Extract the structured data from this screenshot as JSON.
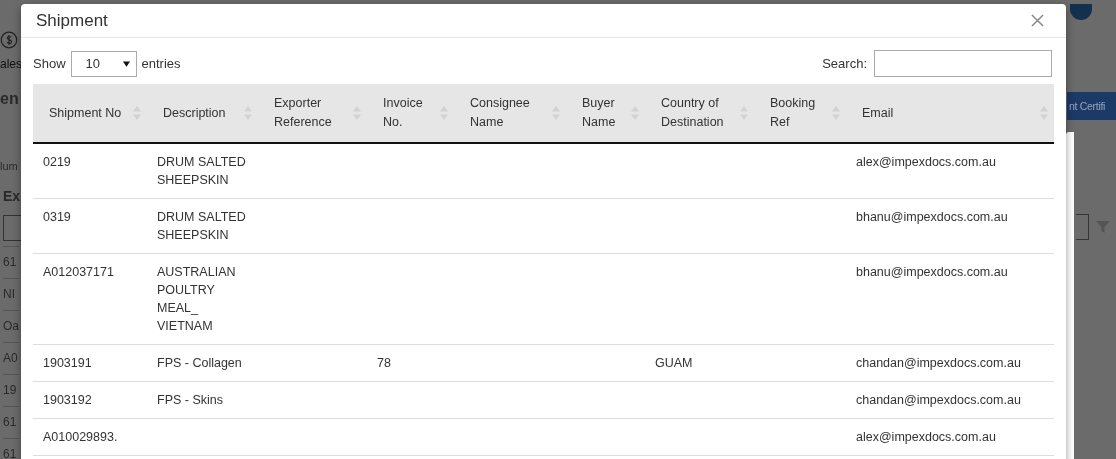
{
  "background": {
    "side_label": "ales",
    "heading": "en",
    "columns_label": "lum",
    "column_head": "Ex",
    "action_button": "nt Certifi",
    "column_cells": [
      "61",
      "NI",
      "Oa",
      "A0",
      "19",
      "61",
      "61"
    ]
  },
  "dialog": {
    "title": "Shipment",
    "length": {
      "label_before": "Show",
      "value": "10",
      "label_after": "entries"
    },
    "search": {
      "label": "Search:"
    },
    "table": {
      "columns": [
        "Shipment No",
        "Description",
        "Exporter Reference",
        "Invoice No.",
        "Consignee Name",
        "Buyer Name",
        "Country of Destination",
        "Booking Ref",
        "Email"
      ],
      "rows": [
        [
          "0219",
          "DRUM SALTED SHEEPSKIN",
          "",
          "",
          "",
          "",
          "",
          "",
          "alex@impexdocs.com.au"
        ],
        [
          "0319",
          "DRUM SALTED SHEEPSKIN",
          "",
          "",
          "",
          "",
          "",
          "",
          "bhanu@impexdocs.com.au"
        ],
        [
          "A012037171",
          "AUSTRALIAN POULTRY MEAL_ VIETNAM",
          "",
          "",
          "",
          "",
          "",
          "",
          "bhanu@impexdocs.com.au"
        ],
        [
          "1903191",
          "FPS - Collagen",
          "",
          "78",
          "",
          "",
          "GUAM",
          "",
          "chandan@impexdocs.com.au"
        ],
        [
          "1903192",
          "FPS - Skins",
          "",
          "",
          "",
          "",
          "",
          "",
          "chandan@impexdocs.com.au"
        ],
        [
          "A010029893.",
          "",
          "",
          "",
          "",
          "",
          "",
          "",
          "alex@impexdocs.com.au"
        ]
      ]
    }
  }
}
